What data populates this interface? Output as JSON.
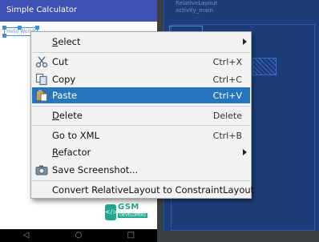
{
  "app": {
    "title": "Simple Calculator",
    "preview_text": "Hello World!"
  },
  "blueprint": {
    "layout_name": "RelativeLayout",
    "layout_id": "activity_main"
  },
  "navbar": {
    "back": "◁",
    "home": "○",
    "recents": "□"
  },
  "watermark": {
    "name": "GSM",
    "sub": "DEVELOPERS",
    "mark": "</>"
  },
  "context_menu": {
    "items": [
      {
        "label": "Select",
        "shortcut": "",
        "submenu": true
      },
      {
        "label": "Cut",
        "shortcut": "Ctrl+X",
        "icon": "scissors-icon"
      },
      {
        "label": "Copy",
        "shortcut": "Ctrl+C",
        "icon": "copy-icon"
      },
      {
        "label": "Paste",
        "shortcut": "Ctrl+V",
        "icon": "paste-icon",
        "highlighted": true
      },
      {
        "label": "Delete",
        "shortcut": "Delete"
      },
      {
        "label": "Go to XML",
        "shortcut": "Ctrl+B"
      },
      {
        "label": "Refactor",
        "shortcut": "",
        "submenu": true
      },
      {
        "label": "Save Screenshot...",
        "shortcut": "",
        "icon": "camera-icon"
      },
      {
        "label": "Convert RelativeLayout to ConstraintLayout",
        "shortcut": ""
      }
    ]
  },
  "colors": {
    "highlight": "#2675bf",
    "appbar": "#3f51b5",
    "blueprint": "#1c3d7a",
    "watermark": "#1fa88e"
  }
}
